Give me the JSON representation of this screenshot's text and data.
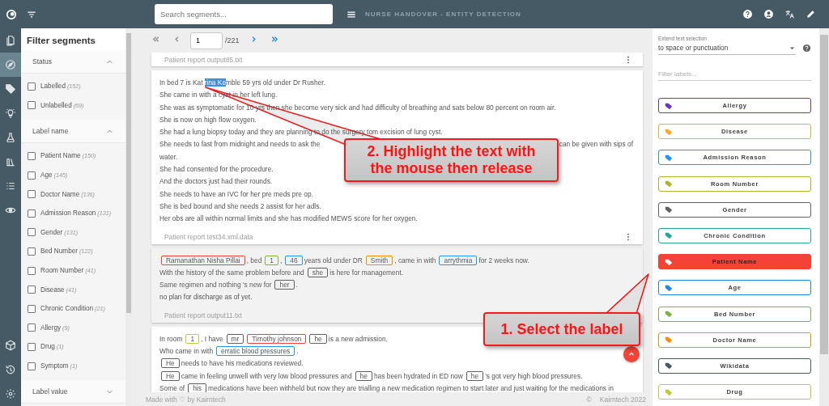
{
  "app": {
    "title": "NURSE HANDOVER - ENTITY DETECTION",
    "search_placeholder": "Search segments..."
  },
  "rail": {
    "top": [
      {
        "kind": "document",
        "selected": false
      },
      {
        "kind": "compass",
        "selected": true
      },
      {
        "kind": "tag",
        "selected": false
      },
      {
        "kind": "bulb",
        "selected": false
      },
      {
        "kind": "flask",
        "selected": false
      },
      {
        "kind": "library",
        "selected": false
      },
      {
        "kind": "list",
        "selected": false
      },
      {
        "kind": "eye",
        "selected": false
      }
    ],
    "bottom": [
      {
        "kind": "cube",
        "selected": false
      },
      {
        "kind": "history",
        "selected": false
      },
      {
        "kind": "gear",
        "selected": false
      }
    ]
  },
  "filters": {
    "title": "Filter segments",
    "sections": [
      {
        "title": "Status",
        "expanded": true,
        "items": [
          {
            "label": "Labelled",
            "count": "(152)",
            "checked": false
          },
          {
            "label": "Unlabelled",
            "count": "(69)",
            "checked": false
          }
        ]
      },
      {
        "title": "Label name",
        "expanded": true,
        "items": [
          {
            "label": "Patient Name",
            "count": "(150)",
            "checked": false
          },
          {
            "label": "Age",
            "count": "(145)",
            "checked": false
          },
          {
            "label": "Doctor Name",
            "count": "(136)",
            "checked": false
          },
          {
            "label": "Admission Reason",
            "count": "(131)",
            "checked": false
          },
          {
            "label": "Gender",
            "count": "(131)",
            "checked": false
          },
          {
            "label": "Bed Number",
            "count": "(122)",
            "checked": false
          },
          {
            "label": "Room Number",
            "count": "(41)",
            "checked": false
          },
          {
            "label": "Disease",
            "count": "(41)",
            "checked": false
          },
          {
            "label": "Chronic Condition",
            "count": "(21)",
            "checked": false
          },
          {
            "label": "Allergy",
            "count": "(9)",
            "checked": false
          },
          {
            "label": "Drug",
            "count": "(1)",
            "checked": false
          },
          {
            "label": "Symptom",
            "count": "(1)",
            "checked": false
          }
        ]
      },
      {
        "title": "Label value",
        "expanded": false
      }
    ]
  },
  "pager": {
    "page": "1",
    "total": "/221",
    "buttons": [
      {
        "kind": "first",
        "disabled": true
      },
      {
        "kind": "prev",
        "disabled": true
      },
      {
        "kind": "next",
        "disabled": false
      },
      {
        "kind": "last",
        "disabled": false
      }
    ]
  },
  "documents": [
    {
      "file": "Patient report output85.txt",
      "has_menu": true,
      "selected": false
    },
    {
      "lines": [
        [
          "In bed 7 is Kat",
          {
            "kind": "selection",
            "text": "rina Ke"
          },
          "mble 59 yrs old under Dr Rusher."
        ],
        "She came in with a cyst in her left lung.",
        "She was as symptomatic for 10 yrs then she become very sick and had difficulty of breathing and sats below 80 percent on room air.",
        "She is now on high flow oxygen.",
        "She had a lung biopsy today and they are planning to do the surgery tom excision of lung cyst.",
        {
          "kind": "covered",
          "left": "She needs to fast from midnight and needs to ask the",
          "right": "can be given with sips of"
        },
        "water.",
        "She had consented for the procedure.",
        "And the doctors just had their rounds.",
        "She needs to have an IVC for her pre meds pre op.",
        "She is bed bound and she needs 2 assist for her adls.",
        "Her obs are all within normal limits and she has modified MEWS score for her oxygen."
      ],
      "file": "Patient report test34.xml.data",
      "has_menu": true,
      "selected": false
    },
    {
      "lines": [
        [
          {
            "kind": "entity",
            "text": "Ramanathan Nisha Pillai",
            "color": "#f44336"
          },
          ", bed",
          {
            "kind": "entity",
            "text": "1",
            "color": "#7cb342"
          },
          ",",
          {
            "kind": "entity",
            "text": "46",
            "color": "#2196f3"
          },
          "years old under DR",
          {
            "kind": "entity",
            "text": "Smith",
            "color": "#fb8c00"
          },
          ", came in with",
          {
            "kind": "entity",
            "text": "arrythmia",
            "color": "#2196f3"
          },
          "for 2 weeks now."
        ],
        [
          "With the history of the same problem before and",
          {
            "kind": "entity",
            "text": "she",
            "color": "#616161"
          },
          "is here for management."
        ],
        [
          "Same regimen and nothing 's new for",
          {
            "kind": "entity",
            "text": "her",
            "color": "#616161"
          },
          "."
        ],
        "no plan for discharge as of yet."
      ],
      "file": "Patient report output11.txt",
      "has_menu": false,
      "selected": true
    },
    {
      "lines": [
        [
          "In room",
          {
            "kind": "entity",
            "text": "1",
            "color": "#c0ca33"
          },
          ", I have",
          {
            "kind": "entity",
            "text": "mr",
            "color": "#616161"
          },
          {
            "kind": "entity",
            "text": "Timothy johnson",
            "color": "#f44336"
          },
          {
            "kind": "entity",
            "text": "he",
            "color": "#616161"
          },
          "is a new admission."
        ],
        [
          "Who came in with",
          {
            "kind": "entity",
            "text": "erratic blood pressures",
            "color": "#2196f3"
          },
          "."
        ],
        [
          {
            "kind": "entity",
            "text": "He",
            "color": "#616161"
          },
          "needs to have his medications reviewed."
        ],
        [
          {
            "kind": "entity",
            "text": "He",
            "color": "#616161"
          },
          "came in feeling unwell with very low blood pressures and",
          {
            "kind": "entity",
            "text": "he",
            "color": "#616161"
          },
          "has been hydrated in ED now",
          {
            "kind": "entity",
            "text": "he",
            "color": "#616161"
          },
          "'s got very high blood pressures."
        ],
        [
          "Some of",
          {
            "kind": "entity",
            "text": "his",
            "color": "#616161"
          },
          "medications have been withheld but now they are trialling a new medication regimen to start later and just waiting for the medications in"
        ]
      ],
      "selected": false
    }
  ],
  "footer": {
    "credit": "Made with ♡ by Kairntech",
    "copyright": "©",
    "company": "Kairntech 2022"
  },
  "labels_panel": {
    "extend_label": "Extend text selection",
    "extend_value": "to space or punctuation",
    "filter_placeholder": "Filter labels...",
    "labels": [
      {
        "name": "Allergy",
        "color": "#673ab7",
        "selected": false
      },
      {
        "name": "Disease",
        "color": "#ffa726",
        "selected": false
      },
      {
        "name": "Admission Reason",
        "color": "#2196f3",
        "selected": false
      },
      {
        "name": "Room Number",
        "color": "#afb42b",
        "selected": false
      },
      {
        "name": "Gender",
        "color": "#616161",
        "selected": false
      },
      {
        "name": "Chronic Condition",
        "color": "#26a69a",
        "selected": false
      },
      {
        "name": "Patient Name",
        "color": "#f44336",
        "selected": true
      },
      {
        "name": "Age",
        "color": "#1e88e5",
        "selected": false
      },
      {
        "name": "Bed Number",
        "color": "#7cb342",
        "selected": false
      },
      {
        "name": "Doctor Name",
        "color": "#fb8c00",
        "selected": false
      },
      {
        "name": "Wikidata",
        "color": "#455a64",
        "selected": false
      },
      {
        "name": "Drug",
        "color": "#c0ca33",
        "selected": false
      }
    ]
  },
  "annotations": [
    {
      "text": "2. Highlight the text with the mouse then release"
    },
    {
      "text": "1. Select the label"
    }
  ]
}
